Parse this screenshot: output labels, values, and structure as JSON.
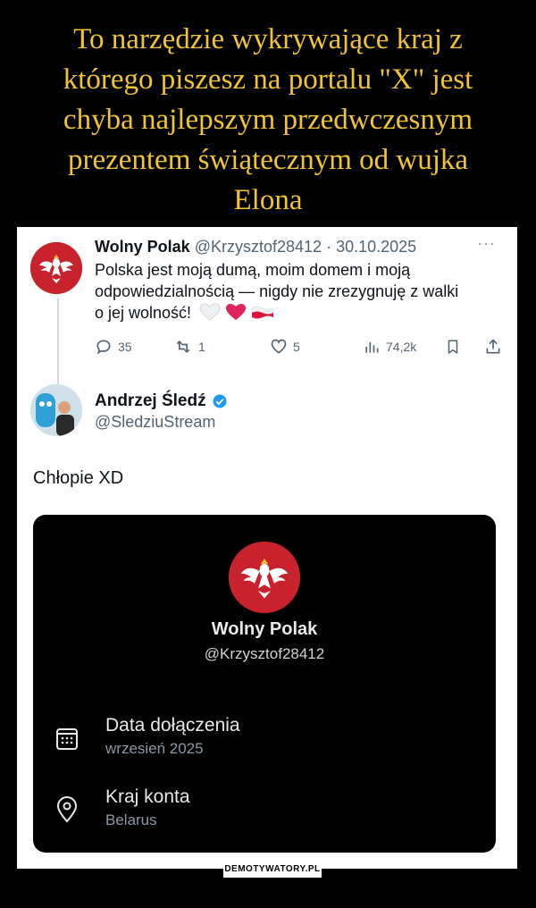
{
  "meme": {
    "title_lines": [
      "To narzędzie wykrywające kraj z",
      "którego piszesz na portalu \"X\" jest",
      "chyba najlepszym przedwczesnym",
      "prezentem świątecznym od wujka",
      "Elona"
    ],
    "footer": "DEMOTYWATORY.PL"
  },
  "tweet1": {
    "name": "Wolny Polak",
    "handle": "@Krzysztof28412",
    "separator": "·",
    "date": "30.10.2025",
    "text": "Polska jest moją dumą, moim domem i moją odpowiedzialnością — nigdy nie zrezygnuję z walki o jej wolność!",
    "emoji": [
      "white-heart",
      "red-heart",
      "poland-flag"
    ],
    "actions": {
      "replies": "35",
      "reposts": "1",
      "likes": "5",
      "views": "74,2k"
    }
  },
  "tweet2": {
    "name": "Andrzej Śledź",
    "handle": "@SledziuStream",
    "verified": true,
    "text": "Chłopie XD"
  },
  "profile_card": {
    "name": "Wolny Polak",
    "handle": "@Krzysztof28412",
    "rows": [
      {
        "icon": "calendar-icon",
        "label": "Data dołączenia",
        "value": "wrzesień 2025"
      },
      {
        "icon": "location-pin-icon",
        "label": "Kraj konta",
        "value": "Belarus"
      }
    ]
  },
  "colors": {
    "title": "#f2c530",
    "verified": "#1d9bf0",
    "heart_red": "#e0245e",
    "eagle_red": "#c8232c"
  }
}
